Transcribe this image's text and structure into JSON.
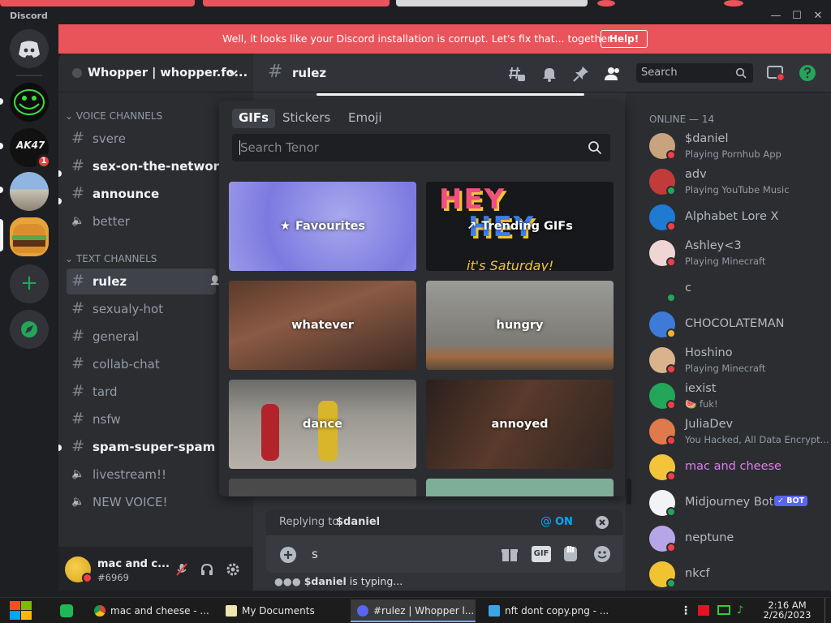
{
  "window": {
    "app_name": "Discord",
    "minimize": "—",
    "maximize": "☐",
    "close": "✕"
  },
  "banner": {
    "text": "Well, it looks like your Discord installation is corrupt. Let's fix that... together.",
    "help_label": "Help!"
  },
  "server_rail": {
    "badge": "1",
    "add_server": "+"
  },
  "server": {
    "name": "Whopper | whopper.fo..."
  },
  "sidebar": {
    "voice_category": "VOICE CHANNELS",
    "voice_channels": [
      {
        "name": "svere",
        "type": "text",
        "unread": false
      },
      {
        "name": "sex-on-the-network",
        "type": "text",
        "unread": true
      },
      {
        "name": "announce",
        "type": "text",
        "unread": true
      },
      {
        "name": "better",
        "type": "voice",
        "unread": false
      }
    ],
    "text_category": "TEXT CHANNELS",
    "text_channels": [
      {
        "name": "rulez",
        "type": "text",
        "active": true
      },
      {
        "name": "sexualy-hot",
        "type": "thread"
      },
      {
        "name": "general",
        "type": "text"
      },
      {
        "name": "collab-chat",
        "type": "text"
      },
      {
        "name": "tard",
        "type": "text"
      },
      {
        "name": "nsfw",
        "type": "text"
      },
      {
        "name": "spam-super-spam",
        "type": "text",
        "unread": true
      },
      {
        "name": "livestream!!",
        "type": "voice"
      },
      {
        "name": "NEW VOICE!",
        "type": "voice"
      }
    ]
  },
  "user_panel": {
    "name": "mac and c...",
    "tag": "#6969"
  },
  "chat_header": {
    "channel": "rulez",
    "search_placeholder": "Search"
  },
  "gif_picker": {
    "tabs": [
      "GIFs",
      "Stickers",
      "Emoji"
    ],
    "search_placeholder": "Search Tenor",
    "tiles": [
      "Favourites",
      "Trending GIFs",
      "whatever",
      "hungry",
      "dance",
      "annoyed"
    ]
  },
  "reply": {
    "prefix": "Replying to",
    "user": "$daniel",
    "mention_label": "ON"
  },
  "composer": {
    "value": "s",
    "gif_label": "GIF"
  },
  "typing": {
    "user": "$daniel",
    "text": "is typing..."
  },
  "members": {
    "heading": "ONLINE — 14",
    "list": [
      {
        "name": "$daniel",
        "status": "Playing Pornhub App",
        "color": "#b5bac1",
        "presence": "#f23f43"
      },
      {
        "name": "adv",
        "status": "Playing YouTube Music",
        "color": "#b5bac1",
        "presence": "#23a55a"
      },
      {
        "name": "Alphabet Lore X",
        "status": "",
        "color": "#b5bac1",
        "presence": "#f23f43"
      },
      {
        "name": "Ashley<3",
        "status": "Playing Minecraft",
        "color": "#b5bac1",
        "presence": "#f23f43"
      },
      {
        "name": "c",
        "status": "",
        "color": "#b5bac1",
        "presence": "#23a55a"
      },
      {
        "name": "CHOCOLATEMAN",
        "status": "",
        "color": "#b5bac1",
        "presence": "#f0b232"
      },
      {
        "name": "Hoshino",
        "status": "Playing Minecraft",
        "color": "#b5bac1",
        "presence": "#f23f43"
      },
      {
        "name": "iexist",
        "status": "🍉 fuk!",
        "color": "#b5bac1",
        "presence": "#f23f43"
      },
      {
        "name": "JuliaDev",
        "status": "You Hacked, All Data Encrypt...",
        "color": "#b5bac1",
        "presence": "#f23f43"
      },
      {
        "name": "mac and cheese",
        "status": "",
        "color": "#e17ef0",
        "presence": "#f23f43"
      },
      {
        "name": "Midjourney Bot",
        "status": "",
        "color": "#b5bac1",
        "presence": "#23a55a",
        "badge": "✓ BOT"
      },
      {
        "name": "neptune",
        "status": "",
        "color": "#b5bac1",
        "presence": "#f23f43"
      },
      {
        "name": "nkcf",
        "status": "",
        "color": "#b5bac1",
        "presence": "#23a55a"
      }
    ]
  },
  "taskbar": {
    "items": [
      "mac and cheese - ...",
      "My Documents",
      "#rulez | Whopper l...",
      "nft dont copy.png - ..."
    ],
    "time": "2:16 AM",
    "date": "2/26/2023"
  },
  "colors": {
    "blurple": "#5865f2",
    "danger": "#f23f43",
    "online": "#23a55a",
    "idle": "#f0b232"
  }
}
